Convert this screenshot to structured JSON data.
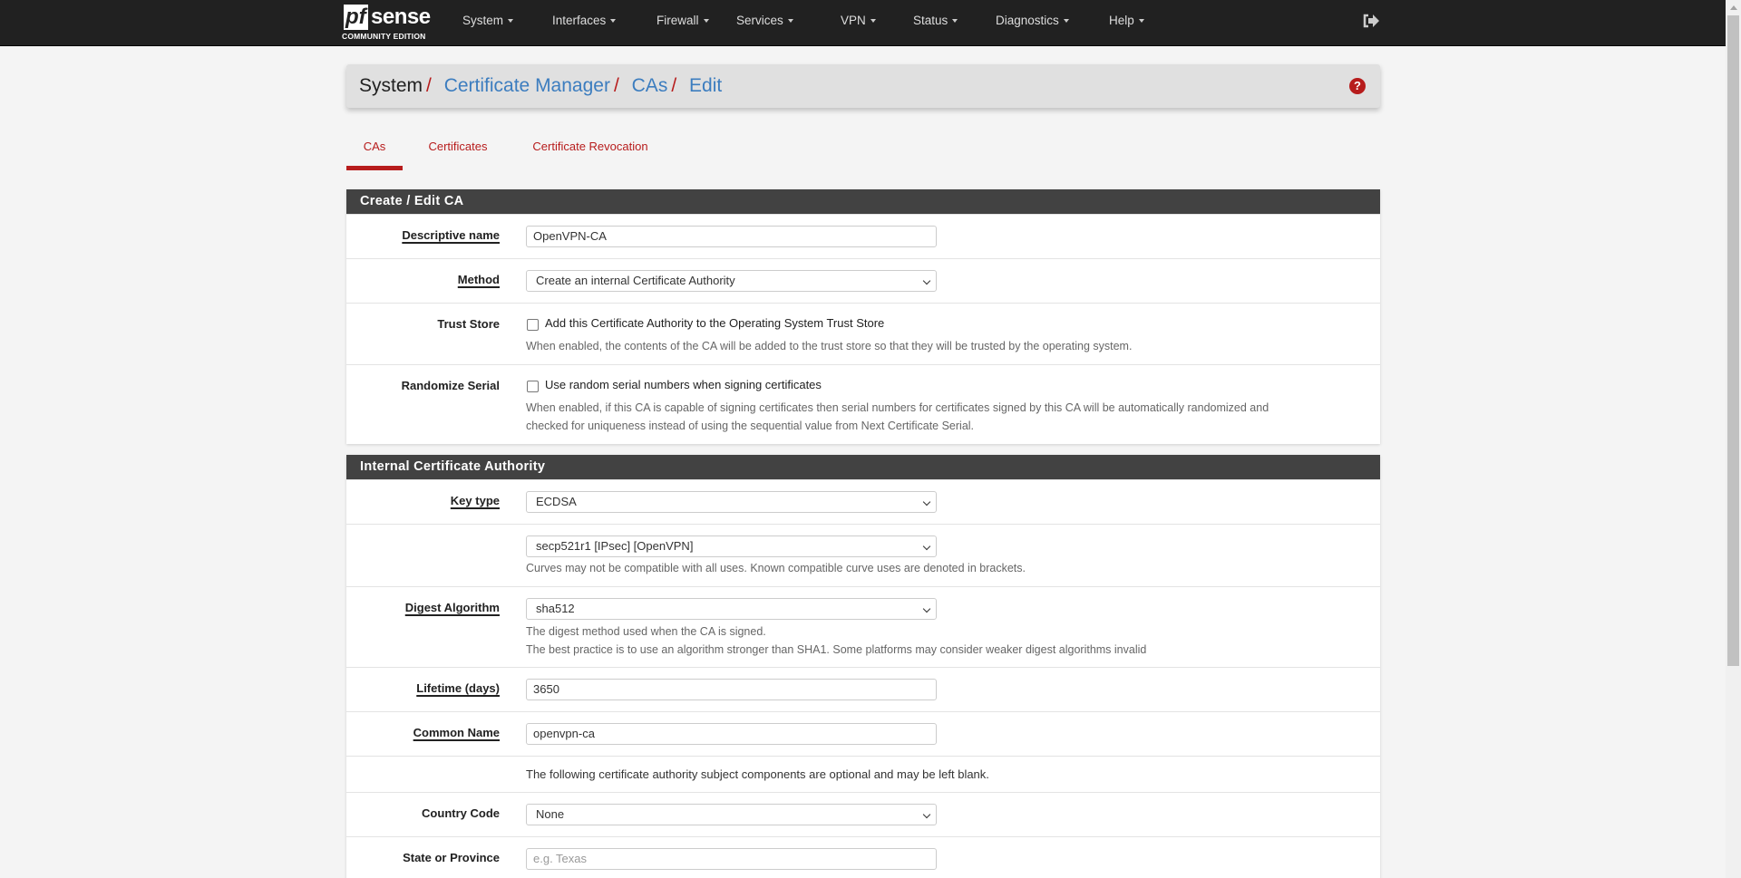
{
  "brand": {
    "logo_text": "pfsense",
    "edition": "COMMUNITY EDITION"
  },
  "nav": {
    "items": [
      "System",
      "Interfaces",
      "Firewall",
      "Services",
      "VPN",
      "Status",
      "Diagnostics",
      "Help"
    ]
  },
  "breadcrumb": {
    "root": "System",
    "items": [
      "Certificate Manager",
      "CAs",
      "Edit"
    ]
  },
  "tabs": [
    {
      "label": "CAs",
      "active": true
    },
    {
      "label": "Certificates"
    },
    {
      "label": "Certificate Revocation"
    }
  ],
  "panel1": {
    "title": "Create / Edit CA",
    "descriptive_name": {
      "label": "Descriptive name",
      "value": "OpenVPN-CA"
    },
    "method": {
      "label": "Method",
      "value": "Create an internal Certificate Authority"
    },
    "trust_store": {
      "label": "Trust Store",
      "checkbox": "Add this Certificate Authority to the Operating System Trust Store",
      "checked": false,
      "hint": "When enabled, the contents of the CA will be added to the trust store so that they will be trusted by the operating system."
    },
    "randomize_serial": {
      "label": "Randomize Serial",
      "checkbox": "Use random serial numbers when signing certificates",
      "checked": false,
      "hint1": "When enabled, if this CA is capable of signing certificates then serial numbers for certificates signed by this CA will be automatically randomized and",
      "hint2": "checked for uniqueness instead of using the sequential value from Next Certificate Serial."
    }
  },
  "panel2": {
    "title": "Internal Certificate Authority",
    "key_type": {
      "label": "Key type",
      "value": "ECDSA"
    },
    "curve": {
      "value": "secp521r1 [IPsec] [OpenVPN]",
      "hint": "Curves may not be compatible with all uses. Known compatible curve uses are denoted in brackets."
    },
    "digest": {
      "label": "Digest Algorithm",
      "value": "sha512",
      "hint1": "The digest method used when the CA is signed.",
      "hint2": "The best practice is to use an algorithm stronger than SHA1. Some platforms may consider weaker digest algorithms invalid"
    },
    "lifetime": {
      "label": "Lifetime (days)",
      "value": "3650"
    },
    "common_name": {
      "label": "Common Name",
      "value": "openvpn-ca"
    },
    "optional_info": "The following certificate authority subject components are optional and may be left blank.",
    "country": {
      "label": "Country Code",
      "value": "None"
    },
    "state": {
      "label": "State or Province",
      "placeholder": "e.g. Texas"
    }
  },
  "colors": {
    "navbar": "#212121",
    "accent": "#b71c1c",
    "link": "#3c7dbf",
    "panel_header": "#424242"
  }
}
